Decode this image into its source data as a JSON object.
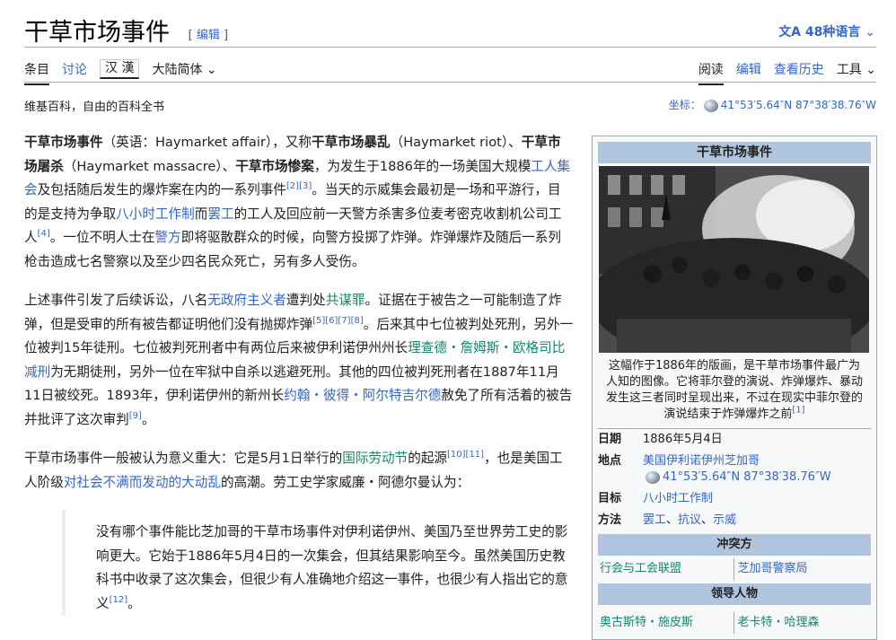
{
  "header": {
    "title": "干草市场事件",
    "edit_link": "编辑",
    "languages": "48种语言"
  },
  "tabs_left": [
    "条目",
    "讨论",
    "汉 漢",
    "大陆简体"
  ],
  "tabs_right": [
    "阅读",
    "编辑",
    "查看历史",
    "工具"
  ],
  "tagline": "维基百科，自由的百科全书",
  "coordinates": {
    "label": "坐标：",
    "value": "41°53′5.64″N 87°38′38.76″W"
  },
  "article": {
    "p1": {
      "b1": "干草市场事件",
      "t1": "（英语：Haymarket affair），又称",
      "b2": "干草市场暴乱",
      "t2": "（Haymarket riot）、",
      "b3": "干草市场屠杀",
      "t3": "（Haymarket massacre）、",
      "b4": "干草市场惨案",
      "t4": "，为发生于1886年的一场美国大规模",
      "l1": "工人集会",
      "t5": "及包括随后发生的爆炸案在内的一系列事件",
      "r1": "[2]",
      "r2": "[3]",
      "t6": "。当天的示威集会最初是一场和平游行，目的是支持为争取",
      "l2": "八小时工作制",
      "t7": "而",
      "l3": "罢工",
      "t8": "的工人及回应前一天警方杀害多位麦考密克收割机公司工人",
      "r3": "[4]",
      "t9": "。一位不明人士在",
      "l4": "警方",
      "t10": "即将驱散群众的时候，向警方投掷了炸弹。炸弹爆炸及随后一系列枪击造成七名警察以及至少四名民众死亡，另有多人受伤。"
    },
    "p2": {
      "t1": "上述事件引发了后续诉讼，八名",
      "l1": "无政府主义者",
      "t2": "遭判处",
      "l2": "共谋罪",
      "t3": "。证据在于被告之一可能制造了炸弹，但是受审的所有被告都证明他们没有抛掷炸弹",
      "r1": "[5]",
      "r2": "[6]",
      "r3": "[7]",
      "r4": "[8]",
      "t4": "。后来其中七位被判处死刑，另外一位被判15年徒刑。七位被判死刑者中有两位后来被伊利诺伊州州长",
      "l3": "理查德・詹姆斯・欧格司比",
      "l4": "减刑",
      "t5": "为无期徒刑，另外一位在牢狱中自杀以逃避死刑。其他的四位被判死刑者在1887年11月11日被绞死。1893年，伊利诺伊州的新州长",
      "l5": "约翰・彼得・阿尔特吉尔德",
      "t6": "赦免了所有活着的被告并批评了这次审判",
      "r5": "[9]",
      "t7": "。"
    },
    "p3": {
      "t1": "干草市场事件一般被认为意义重大：它是5月1日举行的",
      "l1": "国际劳动节",
      "t2": "的起源",
      "r1": "[10]",
      "r2": "[11]",
      "t3": "，也是美国工人阶级",
      "l2": "对社会不满而发动的大动乱",
      "t4": "的高潮。劳工史学家威廉・阿德尔曼认为："
    },
    "quote": {
      "text": "没有哪个事件能比芝加哥的干草市场事件对伊利诺伊州、美国乃至世界劳工史的影响更大。它始于1886年5月4日的一次集会，但其结果影响至今。虽然美国历史教科书中收录了这次集会，但很少有人准确地介绍这一事件，也很少有人指出它的意义",
      "ref": "[12]",
      "end": "。"
    }
  },
  "infobox": {
    "title": "干草市场事件",
    "caption": "这幅作于1886年的版画，是干草市场事件最广为人知的图像。它将菲尔登的演说、炸弹爆炸、暴动发生这三者同时呈现出来，不过在现实中菲尔登的演说结束于炸弹爆炸之前",
    "caption_ref": "[1]",
    "rows": {
      "date_k": "日期",
      "date_v": "1886年5月4日",
      "place_k": "地点",
      "place_v": "美国伊利诺伊州芝加哥",
      "place_coord": "41°53′5.64″N 87°38′38.76″W",
      "goal_k": "目标",
      "goal_v": "八小时工作制",
      "method_k": "方法",
      "method_v1": "罢工",
      "method_v2": "抗议",
      "method_v3": "示威"
    },
    "sections": {
      "conflict": "冲突方",
      "leaders": "领导人物"
    },
    "conflict_left": "行会与工会联盟",
    "conflict_right": "芝加哥警察局",
    "leader_left": "奥古斯特・施皮斯",
    "leader_right": "老卡特・哈理森"
  },
  "colors": {
    "link": "#3366cc",
    "infobox_header": "#b0c4de",
    "infobox_bg": "#f8f9fa"
  }
}
